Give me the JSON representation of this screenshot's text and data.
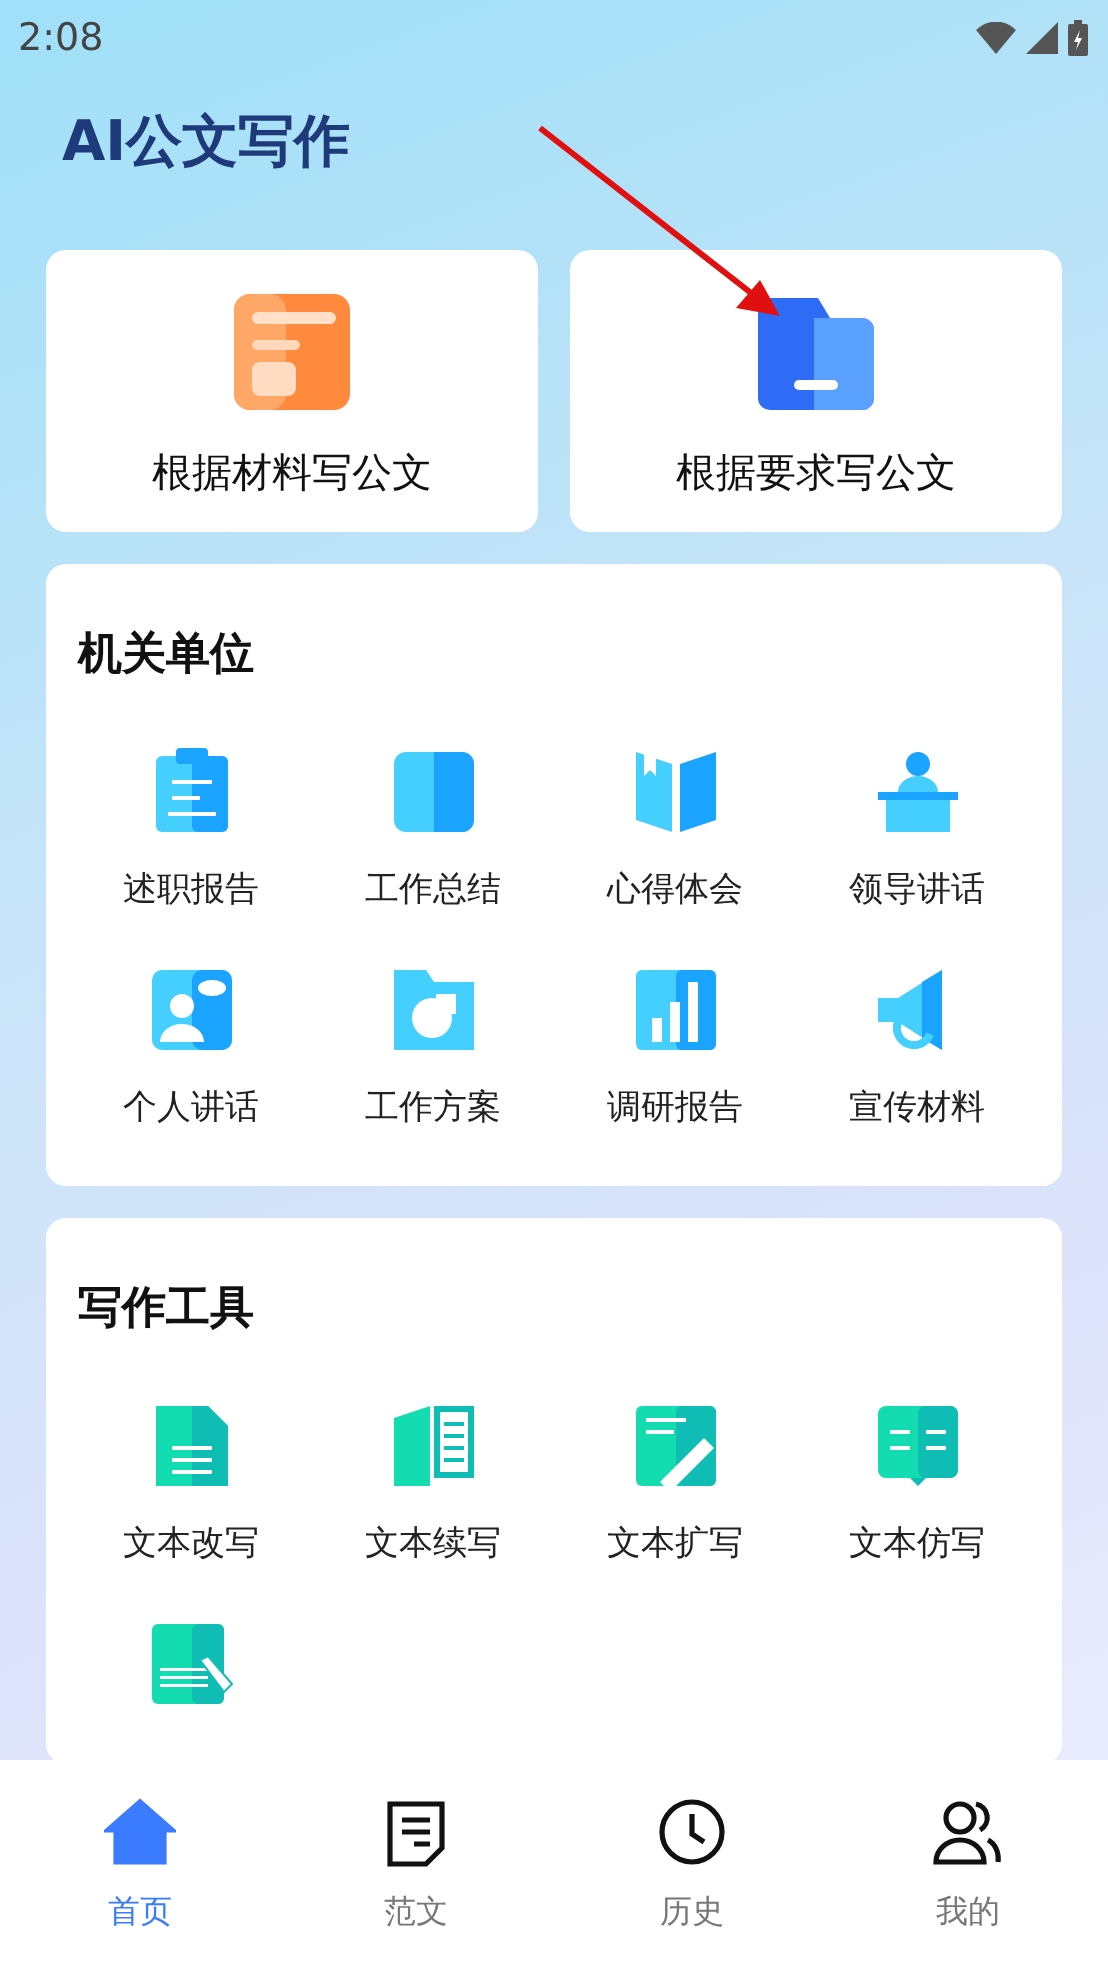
{
  "status_bar": {
    "time": "2:08"
  },
  "title": "AI公文写作",
  "top_cards": [
    {
      "label": "根据材料写公文"
    },
    {
      "label": "根据要求写公文"
    }
  ],
  "sections": [
    {
      "title": "机关单位",
      "items": [
        {
          "kind": "labeled",
          "label": "述职报告"
        },
        {
          "kind": "labeled",
          "label": "工作总结"
        },
        {
          "kind": "labeled",
          "label": "心得体会"
        },
        {
          "kind": "labeled",
          "label": "领导讲话"
        },
        {
          "kind": "labeled",
          "label": "个人讲话"
        },
        {
          "kind": "labeled",
          "label": "工作方案"
        },
        {
          "kind": "labeled",
          "label": "调研报告"
        },
        {
          "kind": "labeled",
          "label": "宣传材料"
        }
      ]
    },
    {
      "title": "写作工具",
      "items": [
        {
          "kind": "labeled",
          "label": "文本改写"
        },
        {
          "kind": "labeled",
          "label": "文本续写"
        },
        {
          "kind": "labeled",
          "label": "文本扩写"
        },
        {
          "kind": "labeled",
          "label": "文本仿写"
        },
        {
          "kind": "icon_only"
        }
      ]
    }
  ],
  "tabs": [
    {
      "label": "首页",
      "selected": true
    },
    {
      "label": "范文",
      "selected": false
    },
    {
      "label": "历史",
      "selected": false
    },
    {
      "label": "我的",
      "selected": false
    }
  ]
}
